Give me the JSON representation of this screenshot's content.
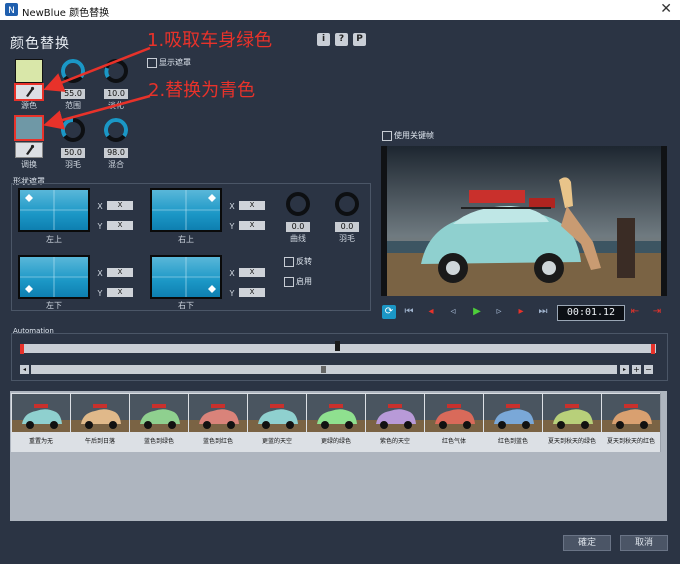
{
  "window": {
    "title": "NewBlue 颜色替换",
    "close_glyph": "✕"
  },
  "panel_title": "颜色替换",
  "header_buttons": [
    {
      "label": "i"
    },
    {
      "label": "?"
    },
    {
      "label": "P"
    }
  ],
  "annotations": {
    "step1": "1.吸取车身绿色",
    "step2": "2.替换为青色"
  },
  "colors": {
    "source": "#d9e7a9",
    "replace": "#6f98a6",
    "annotation": "#e8322a",
    "accent": "#1b97c6"
  },
  "source": {
    "label": "源色",
    "range_label": "范围",
    "range_value": "55.0",
    "fade_label": "淡化",
    "fade_value": "10.0"
  },
  "show_mask": {
    "label": "显示遮罩"
  },
  "replace": {
    "label": "调换",
    "feather_label": "羽毛",
    "feather_value": "50.0",
    "blend_label": "混合",
    "blend_value": "98.0"
  },
  "shape_mask": {
    "title": "形状遮罩",
    "corners": [
      {
        "label": "左上",
        "x": "X",
        "y": "X"
      },
      {
        "label": "右上",
        "x": "X",
        "y": "X"
      },
      {
        "label": "左下",
        "x": "X",
        "y": "X"
      },
      {
        "label": "右下",
        "x": "X",
        "y": "X"
      }
    ],
    "x_label": "X",
    "y_label": "Y",
    "curve_label": "曲线",
    "curve_value": "0.0",
    "feather_label": "羽毛",
    "feather_value": "0.0",
    "invert_label": "反转",
    "enable_label": "启用"
  },
  "keyframe": {
    "label": "使用关键帧"
  },
  "transport": {
    "time": "00:01.12"
  },
  "automation": {
    "label": "Automation"
  },
  "presets": [
    {
      "label": "重置为无"
    },
    {
      "label": "午后到日落"
    },
    {
      "label": "蓝色到绿色"
    },
    {
      "label": "蓝色到红色"
    },
    {
      "label": "更蓝的天空"
    },
    {
      "label": "更绿的绿色"
    },
    {
      "label": "紫色的天空"
    },
    {
      "label": "红色气体"
    },
    {
      "label": "红色到蓝色"
    },
    {
      "label": "夏天到秋天的绿色"
    },
    {
      "label": "夏天到秋天的红色"
    }
  ],
  "footer": {
    "ok_label": "確定",
    "cancel_label": "取消"
  }
}
